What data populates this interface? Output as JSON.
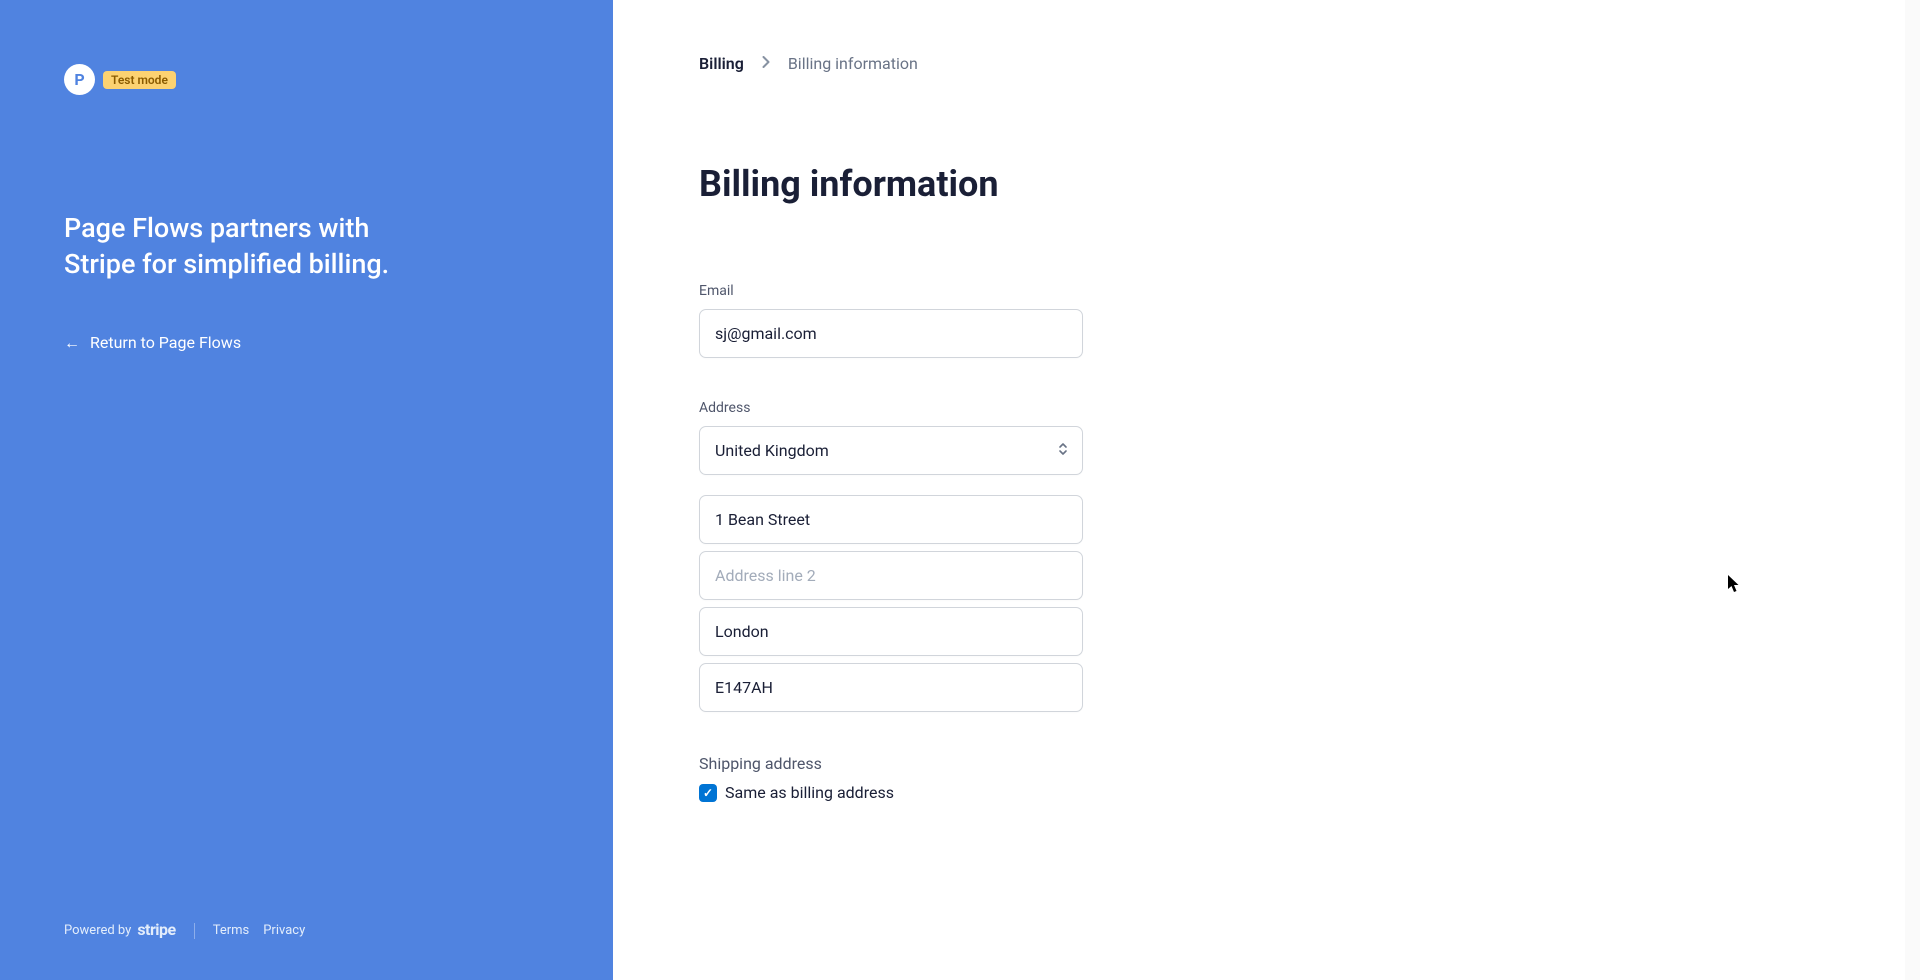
{
  "left": {
    "logo_letter": "P",
    "test_mode_badge": "Test mode",
    "headline": "Page Flows partners with Stripe for simplified billing.",
    "return_link": "Return to Page Flows",
    "powered_by": "Powered by",
    "stripe_wordmark": "stripe",
    "terms": "Terms",
    "privacy": "Privacy"
  },
  "breadcrumb": {
    "parent": "Billing",
    "current": "Billing information"
  },
  "page_title": "Billing information",
  "form": {
    "email_label": "Email",
    "email_value": "sj@gmail.com",
    "address_label": "Address",
    "country_value": "United Kingdom",
    "addr1_value": "1 Bean Street",
    "addr2_placeholder": "Address line 2",
    "city_value": "London",
    "postal_value": "E147AH",
    "shipping_label": "Shipping address",
    "same_as_billing_label": "Same as billing address",
    "same_as_billing_checked": true
  }
}
